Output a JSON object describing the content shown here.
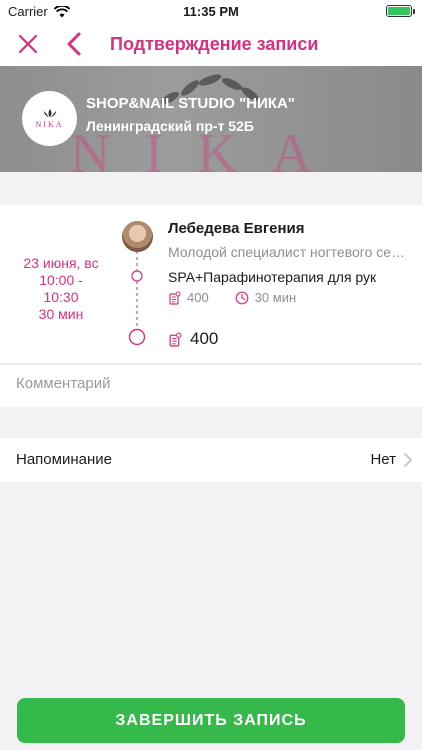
{
  "status_bar": {
    "carrier": "Carrier",
    "time": "11:35 PM"
  },
  "header": {
    "title": "Подтверждение записи"
  },
  "studio": {
    "logo_text": "NIKA",
    "bg_text": "NIKA",
    "name": "SHOP&NAIL STUDIO \"НИКА\"",
    "address": "Ленинградский пр-т 52Б"
  },
  "booking": {
    "date_lines": [
      "23 июня, вс",
      "10:00 -",
      "10:30",
      "30 мин"
    ],
    "master_name": "Лебедева Евгения",
    "master_role": "Молодой специалист ногтевого сервиса",
    "service": {
      "name": "SPA+Парафинотерапия для рук",
      "price": "400",
      "duration": "30 мин"
    },
    "total": "400"
  },
  "comment": {
    "placeholder": "Комментарий"
  },
  "reminder": {
    "label": "Напоминание",
    "value": "Нет"
  },
  "finish_button": {
    "label": "ЗАВЕРШИТЬ ЗАПИСЬ"
  },
  "colors": {
    "accent": "#d6307f",
    "button": "#36b94b"
  }
}
